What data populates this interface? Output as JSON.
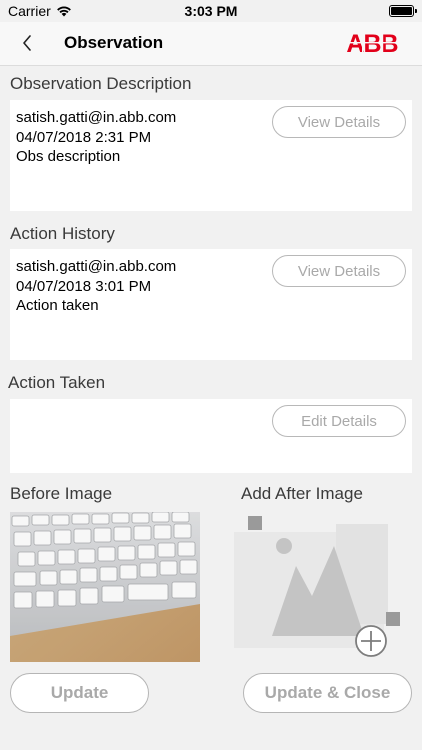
{
  "status": {
    "carrier": "Carrier",
    "time": "3:03 PM",
    "wifi_icon": "wifi-icon",
    "battery_level": 1.0
  },
  "nav": {
    "back_icon": "chevron-left-icon",
    "title": "Observation",
    "logo_text": "ABB",
    "brand_color": "#e2001a"
  },
  "observation": {
    "title": "Observation Description",
    "email": "satish.gatti@in.abb.com",
    "date": "04/07/2018 2:31 PM",
    "text": "Obs description",
    "button": "View Details"
  },
  "history": {
    "title": "Action History",
    "email": "satish.gatti@in.abb.com",
    "date": "04/07/2018 3:01 PM",
    "text": "Action taken",
    "button": "View Details"
  },
  "taken": {
    "title": "Action Taken",
    "button": "Edit Details"
  },
  "images": {
    "before_title": "Before Image",
    "after_title": "Add After Image",
    "after_icon": "add-image-placeholder-icon"
  },
  "buttons": {
    "update": "Update",
    "update_close": "Update & Close"
  }
}
